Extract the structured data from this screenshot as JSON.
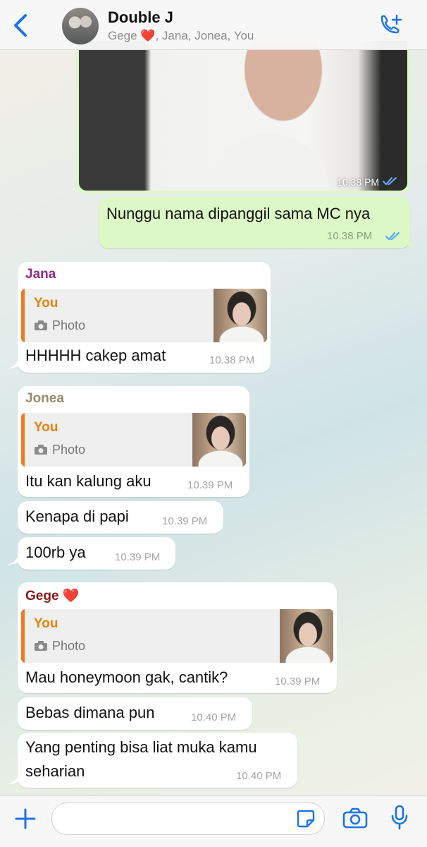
{
  "header": {
    "title": "Double J",
    "members_prefix": "Gege ",
    "members_heart": "❤️",
    "members_rest": ", Jana, Jonea, You"
  },
  "messages": {
    "photo_time": "10.38 PM",
    "out1": {
      "text": "Nunggu nama dipanggil sama MC nya",
      "time": "10.38 PM"
    },
    "jana": {
      "sender": "Jana",
      "quote_author": "You",
      "quote_type": "Photo",
      "text": "HHHHH cakep amat",
      "time": "10.38 PM"
    },
    "jonea": {
      "sender": "Jonea",
      "quote_author": "You",
      "quote_type": "Photo",
      "text": "Itu kan kalung aku",
      "time": "10.39 PM"
    },
    "jonea2": {
      "text": "Kenapa di papi",
      "time": "10.39 PM"
    },
    "jonea3": {
      "text": "100rb ya",
      "time": "10.39 PM"
    },
    "gege": {
      "sender": "Gege",
      "sender_heart": "❤️",
      "quote_author": "You",
      "quote_type": "Photo",
      "text": "Mau honeymoon gak, cantik?",
      "time": "10.39 PM"
    },
    "gege2": {
      "text": "Bebas dimana pun",
      "time": "10.40 PM"
    },
    "gege3": {
      "line1": "Yang penting bisa liat muka kamu",
      "line2": "seharian",
      "time": "10.40 PM"
    }
  },
  "colors": {
    "outgoing": "#dcf8c6",
    "incoming": "#ffffff",
    "accent": "#1a73e8",
    "jana": "#8e2a8e",
    "jonea": "#9b8a6a",
    "gege": "#8b1a1a",
    "quote_you": "#e8830f"
  },
  "icons": [
    "back-chevron-icon",
    "add-call-icon",
    "read-ticks-icon",
    "camera-icon",
    "plus-icon",
    "sticker-icon",
    "microphone-icon"
  ]
}
